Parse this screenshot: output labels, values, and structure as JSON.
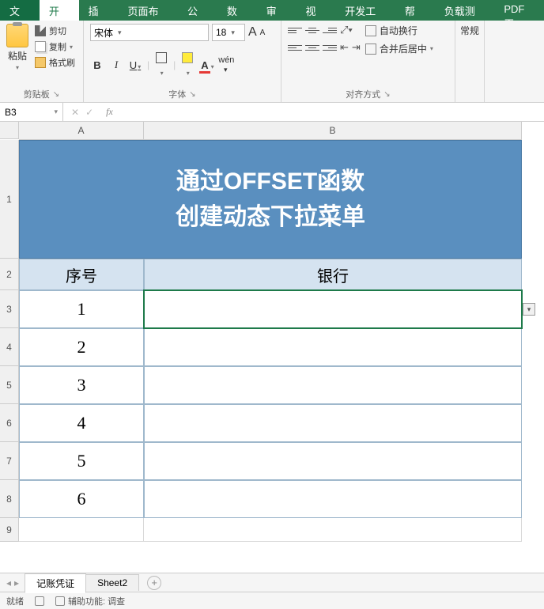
{
  "menu": {
    "file": "文件",
    "home": "开始",
    "insert": "插入",
    "layout": "页面布局",
    "formula": "公式",
    "data": "数据",
    "review": "审阅",
    "view": "视图",
    "dev": "开发工具",
    "help": "帮助",
    "load": "负载测试",
    "pdf": "PDF工"
  },
  "ribbon": {
    "paste": "粘贴",
    "cut": "剪切",
    "copy": "复制",
    "fmt": "格式刷",
    "clipboard_group": "剪贴板",
    "font_name": "宋体",
    "font_size": "18",
    "font_group": "字体",
    "wrap": "自动换行",
    "merge": "合并后居中",
    "align_group": "对齐方式",
    "number_hint": "常规"
  },
  "fx": {
    "namebox": "B3",
    "formula": ""
  },
  "sheet": {
    "cols": [
      "A",
      "B"
    ],
    "title_line1": "通过OFFSET函数",
    "title_line2": "创建动态下拉菜单",
    "hdrA": "序号",
    "hdrB": "银行",
    "rows": [
      {
        "n": "1",
        "v": ""
      },
      {
        "n": "2",
        "v": ""
      },
      {
        "n": "3",
        "v": ""
      },
      {
        "n": "4",
        "v": ""
      },
      {
        "n": "5",
        "v": ""
      },
      {
        "n": "6",
        "v": ""
      }
    ]
  },
  "tabs": {
    "active": "记账凭证",
    "other": "Sheet2"
  },
  "status": {
    "ready": "就绪",
    "acc": "辅助功能: 调查"
  },
  "row_heights": {
    "r1": 150,
    "r2": 40,
    "rdata": 48,
    "r9": 30
  }
}
